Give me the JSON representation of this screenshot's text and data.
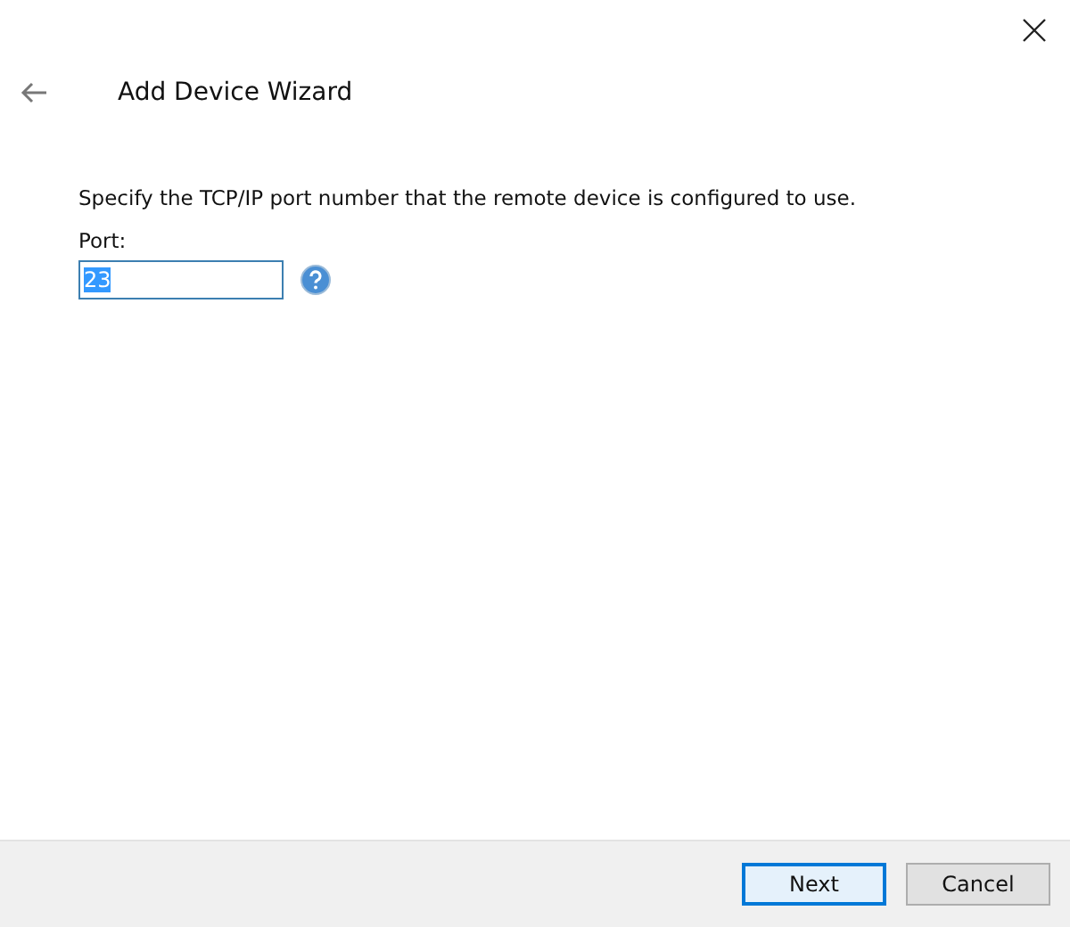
{
  "window": {
    "title": "Add Device Wizard"
  },
  "instruction": "Specify the TCP/IP port number that the remote device is configured to use.",
  "port": {
    "label": "Port:",
    "value": "23",
    "value_selected": true
  },
  "buttons": [
    {
      "label": "Next",
      "default": true
    },
    {
      "label": "Cancel",
      "default": false
    }
  ]
}
